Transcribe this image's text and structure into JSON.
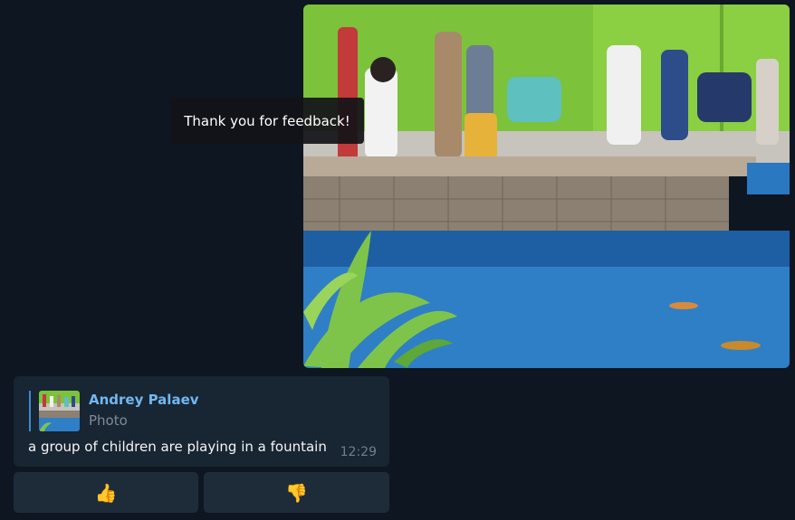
{
  "toast": {
    "text": "Thank you for feedback!"
  },
  "photo_message": {
    "alt": "a group of children are playing in a fountain"
  },
  "bot_message": {
    "reply": {
      "name": "Andrey Palaev",
      "subtitle": "Photo"
    },
    "text": "a group of children are playing in a fountain",
    "time": "12:29"
  },
  "keyboard": {
    "like_icon": "👍",
    "dislike_icon": "👎"
  },
  "colors": {
    "background": "#0e1621",
    "bubble": "#182533",
    "accent": "#71b8f1",
    "button": "#1e2c3a"
  }
}
